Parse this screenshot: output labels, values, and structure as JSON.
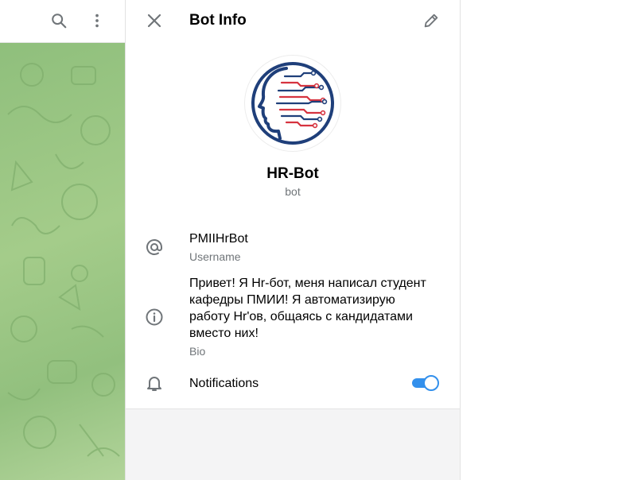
{
  "left_header": {
    "search_icon": "search-icon",
    "menu_icon": "more-vertical-icon"
  },
  "info_panel": {
    "title": "Bot Info",
    "close_icon": "close-icon",
    "edit_icon": "pencil-icon",
    "bot_name": "HR-Bot",
    "bot_status": "bot",
    "username_value": "PMIIHrBot",
    "username_label": "Username",
    "bio_value": "Привет! Я Hr-бот, меня написал студент кафедры ПМИИ! Я автоматизирую работу Hr'ов, общаясь с кандидатами вместо них!",
    "bio_label": "Bio",
    "notifications_label": "Notifications",
    "notifications_enabled": true
  },
  "colors": {
    "accent": "#3390ec",
    "secondary_text": "#707579",
    "logo_navy": "#1f3f7a",
    "logo_red": "#d6333f",
    "chat_background": "#9fc98a"
  }
}
